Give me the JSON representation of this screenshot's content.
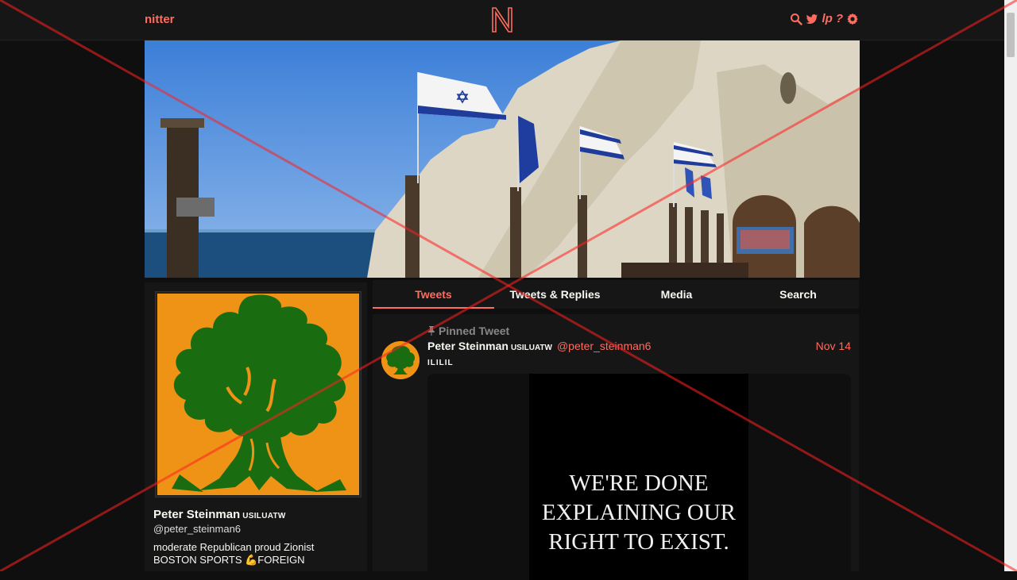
{
  "nav": {
    "brand": "nitter",
    "icons": [
      "search-icon",
      "twitter-bird-icon",
      "lp-icon",
      "help-icon",
      "gear-icon"
    ],
    "lp_label": "lp",
    "help_label": "?"
  },
  "profile": {
    "fullname": "Peter Steinman",
    "badge": "USILUATW",
    "username": "@peter_steinman6",
    "bio_line1": "moderate Republican proud Zionist",
    "bio_line2": "BOSTON SPORTS 💪FOREIGN"
  },
  "tabs": [
    {
      "label": "Tweets",
      "active": true
    },
    {
      "label": "Tweets & Replies",
      "active": false
    },
    {
      "label": "Media",
      "active": false
    },
    {
      "label": "Search",
      "active": false
    }
  ],
  "tweet": {
    "pinned_label": "Pinned Tweet",
    "fullname": "Peter Steinman",
    "badge": "USILUATW",
    "username": "@peter_steinman6",
    "date": "Nov 14",
    "text": "ILILIL",
    "media_line1": "WE'RE DONE",
    "media_line2": "EXPLAINING OUR",
    "media_line3": "RIGHT TO EXIST."
  },
  "colors": {
    "accent": "#ff6c60",
    "background": "#0f0f0f",
    "panel": "#161616",
    "avatar_bg": "#ee9316",
    "tree": "#196d10"
  }
}
